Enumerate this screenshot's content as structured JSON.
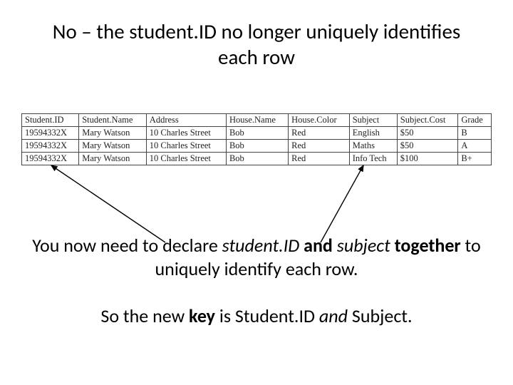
{
  "title": "No – the student.ID no longer uniquely identifies each row",
  "table": {
    "headers": [
      "Student.ID",
      "Student.Name",
      "Address",
      "House.Name",
      "House.Color",
      "Subject",
      "Subject.Cost",
      "Grade"
    ],
    "rows": [
      [
        "19594332X",
        "Mary Watson",
        "10 Charles Street",
        "Bob",
        "Red",
        "English",
        "$50",
        "B"
      ],
      [
        "19594332X",
        "Mary Watson",
        "10 Charles Street",
        "Bob",
        "Red",
        "Maths",
        "$50",
        "A"
      ],
      [
        "19594332X",
        "Mary Watson",
        "10 Charles Street",
        "Bob",
        "Red",
        "Info Tech",
        "$100",
        "B+"
      ]
    ]
  },
  "para1": {
    "pre": "You now need to declare ",
    "i1": "student.ID ",
    "mid1": "and ",
    "i2": "subject ",
    "b1": "together ",
    "post": "to uniquely identify each row."
  },
  "para2": {
    "pre": "So the new ",
    "b1": "key ",
    "mid": "is Student.ID ",
    "i1": "and ",
    "post": "Subject."
  }
}
